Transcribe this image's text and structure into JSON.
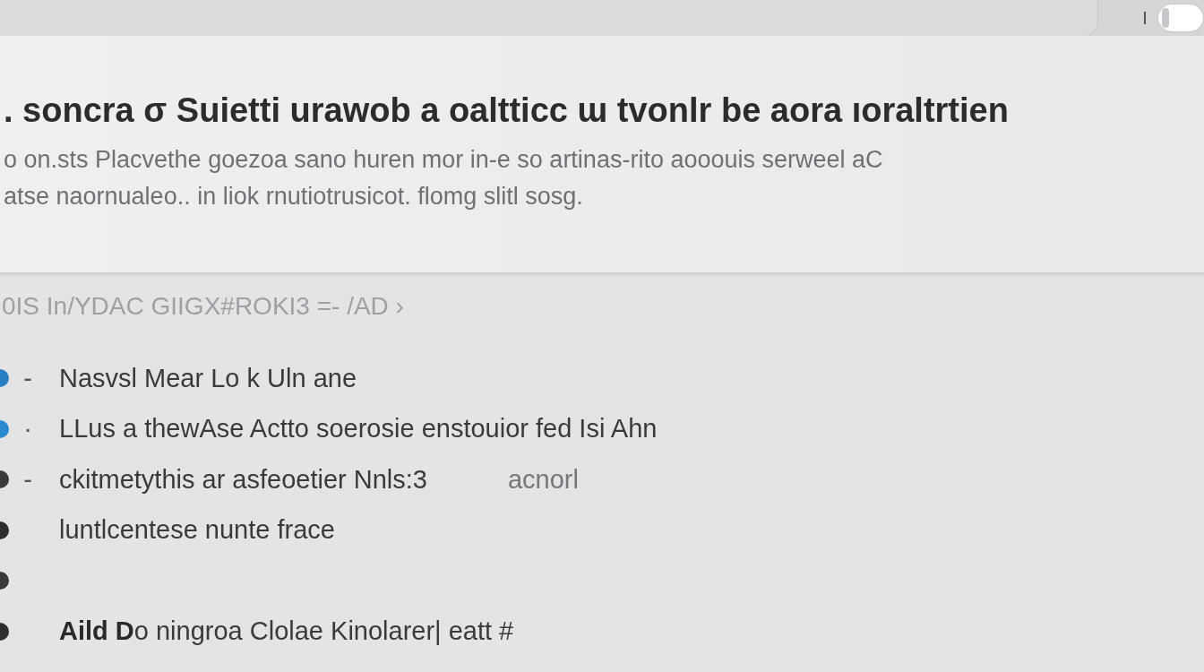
{
  "toolbar": {
    "toggle": {
      "on": false
    }
  },
  "header": {
    "title": ". soncra σ Suietti urawob a oaltticc ɯ tvonlr  be aora ıoraltrtien",
    "description": [
      "o on.sts Placvethe goezoa sano  huren mor  in-e so artinas-rito aooouis serweel  aC",
      "atse naornualeo.. in liok rnutiotrusicot. flomg slitl sosg."
    ]
  },
  "section_label": "0IS In/YDAC GIIGX#ROKI3 =-  /AD ›",
  "items": [
    {
      "color": "#2a7fc4",
      "dash": "-",
      "text": "Nasvsl Mear Lo k Uln ane"
    },
    {
      "color": "#2a8ad0",
      "dash": "·",
      "text": "LLus    a thewAse Actto soerosie enstouior fed  Isi  Ahn"
    },
    {
      "color": "#3a3a3c",
      "dash": "-",
      "text": "ckitmetythis ar asfeoetier Nnls:3",
      "aside": "acnorl"
    },
    {
      "color": "#2e2e30",
      "text": "luntlcentese nunte  frace"
    },
    {
      "color": "#3a3a3c"
    },
    {
      "color": "#2e2e30",
      "text": "**Aild D**o ningroa Clolae  Kinolarer| eatt #"
    }
  ]
}
